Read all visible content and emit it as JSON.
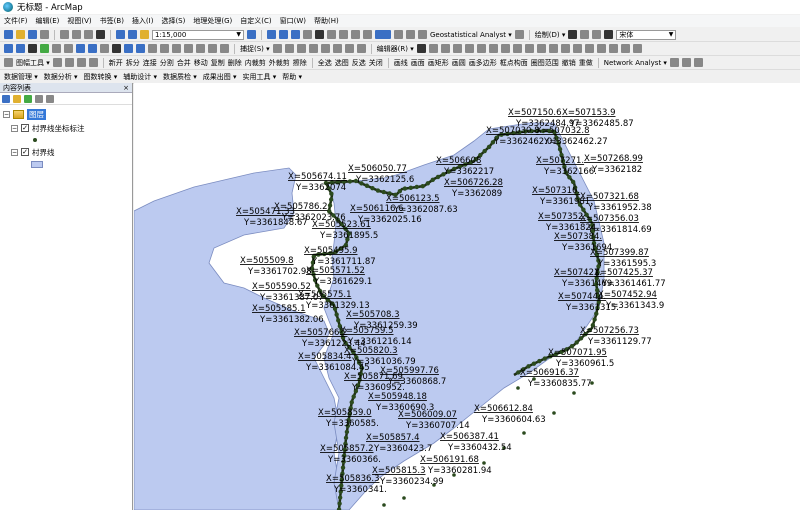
{
  "window": {
    "title": "无标题 - ArcMap"
  },
  "menu": [
    "文件(F)",
    "编辑(E)",
    "视图(V)",
    "书签(B)",
    "插入(I)",
    "选择(S)",
    "地理处理(G)",
    "自定义(C)",
    "窗口(W)",
    "帮助(H)"
  ],
  "toolbar1": {
    "scale": "1:15,000",
    "geostat": "Geostatistical Analyst ▾",
    "draw": "绘制(D) ▾",
    "font": "宋体"
  },
  "toolbar2": {
    "snap": "捕捉(S) ▾",
    "editor": "编辑器(R) ▾"
  },
  "toolbar2b": {
    "georef": "图幅工具 ▾",
    "tools": [
      "新开",
      "拆分",
      "连接",
      "分割",
      "合并",
      "移动",
      "复制",
      "删除",
      "内裁剪",
      "外裁剪",
      "擦除"
    ],
    "tools2": [
      "全选",
      "选图",
      "反选",
      "关闭"
    ],
    "tools3": [
      "画线",
      "画面",
      "画矩形",
      "画圆",
      "画多边形",
      "框点构面",
      "圈图范围",
      "撤销",
      "重做"
    ],
    "network": "Network Analyst ▾"
  },
  "toolbar3": [
    "数据管理 ▾",
    "数据分析 ▾",
    "图数转换 ▾",
    "辅助设计 ▾",
    "数据质检 ▾",
    "成果出图 ▾",
    "实用工具 ▾",
    "帮助 ▾"
  ],
  "toc": {
    "title": "内容列表",
    "close": "×",
    "root": "图层",
    "layers": [
      {
        "name": "村界线坐标标注",
        "checked": true
      },
      {
        "name": "村界线",
        "checked": true
      }
    ]
  },
  "map_labels": [
    {
      "x": "X=507150.6",
      "y": "Y=3362484.97"
    },
    {
      "x": "X=507153.9",
      "y": "Y=3362485.87"
    },
    {
      "x": "X=507030.8",
      "y": "Y=3362462.01"
    },
    {
      "x": "X=507032.8",
      "y": "Y=3362462.27"
    },
    {
      "x": "X=506608",
      "y": "Y=3362217"
    },
    {
      "x": "X=506050.77",
      "y": "Y=3362125.6"
    },
    {
      "x": "X=505674.11",
      "y": "Y=3362074"
    },
    {
      "x": "X=505471.33",
      "y": "Y=3361848.67"
    },
    {
      "x": "X=505786.2",
      "y": "Y=3362023.76"
    },
    {
      "x": "X=505523.61",
      "y": "Y=3361895.5"
    },
    {
      "x": "X=506116.6",
      "y": "Y=3362025.16"
    },
    {
      "x": "X=506123.5",
      "y": "Y=3362087.63"
    },
    {
      "x": "X=506726.28",
      "y": "Y=3362089"
    },
    {
      "x": "X=507271.",
      "y": "Y=3362166."
    },
    {
      "x": "X=507268.99",
      "y": "Y=3362182"
    },
    {
      "x": "X=507316.",
      "y": "Y=3361981."
    },
    {
      "x": "X=507321.68",
      "y": "Y=3361952.38"
    },
    {
      "x": "X=507352.",
      "y": "Y=3361824."
    },
    {
      "x": "X=507356.03",
      "y": "Y=3361814.69"
    },
    {
      "x": "X=507384.",
      "y": "Y=3361694."
    },
    {
      "x": "X=507399.87",
      "y": "Y=3361595.3"
    },
    {
      "x": "X=507421.",
      "y": "Y=3361469."
    },
    {
      "x": "X=507425.37",
      "y": "Y=3361461.77"
    },
    {
      "x": "X=507444.",
      "y": "Y=3361315."
    },
    {
      "x": "X=507452.94",
      "y": "Y=3361343.9"
    },
    {
      "x": "X=505509.8",
      "y": "Y=3361702.98"
    },
    {
      "x": "X=505495.9",
      "y": "Y=3361711.87"
    },
    {
      "x": "X=505571.52",
      "y": "Y=3361629.1"
    },
    {
      "x": "X=505590.52",
      "y": "Y=3361387.07"
    },
    {
      "x": "X=505575.1",
      "y": "Y=3361329.13"
    },
    {
      "x": "X=505585.1",
      "y": "Y=3361382.06"
    },
    {
      "x": "X=505708.3",
      "y": "Y=3361259.39"
    },
    {
      "x": "X=505766.2",
      "y": "Y=3361223.44"
    },
    {
      "x": "X=505759.5",
      "y": "Y=3361216.14"
    },
    {
      "x": "X=507256.73",
      "y": "Y=3361129.77"
    },
    {
      "x": "X=505834.4",
      "y": "Y=3361084.45"
    },
    {
      "x": "X=505820.3",
      "y": "Y=3361036.79"
    },
    {
      "x": "X=507071.95",
      "y": "Y=3360961.5"
    },
    {
      "x": "X=505997.76",
      "y": "Y=3360868.7"
    },
    {
      "x": "X=505871.69",
      "y": "Y=3360952."
    },
    {
      "x": "X=506916.37",
      "y": "Y=3360835.77"
    },
    {
      "x": "X=505948.18",
      "y": "Y=3360690.3"
    },
    {
      "x": "X=506009.07",
      "y": "Y=3360707.14"
    },
    {
      "x": "X=505859.0",
      "y": "Y=3360585."
    },
    {
      "x": "X=506612.84",
      "y": "Y=3360604.63"
    },
    {
      "x": "X=505857.4",
      "y": "Y=3360423.7"
    },
    {
      "x": "X=505857.2",
      "y": "Y=3360366."
    },
    {
      "x": "X=506387.41",
      "y": "Y=3360432.54"
    },
    {
      "x": "X=506191.68",
      "y": "Y=3360281.94"
    },
    {
      "x": "X=505815.3",
      "y": "Y=3360234.99"
    },
    {
      "x": "X=505836.3",
      "y": "Y=3360341."
    }
  ],
  "colors": {
    "polygon_fill": "#bccaf0",
    "polygon_stroke": "#7b8cc0",
    "vertex": "#2b4a1e"
  }
}
